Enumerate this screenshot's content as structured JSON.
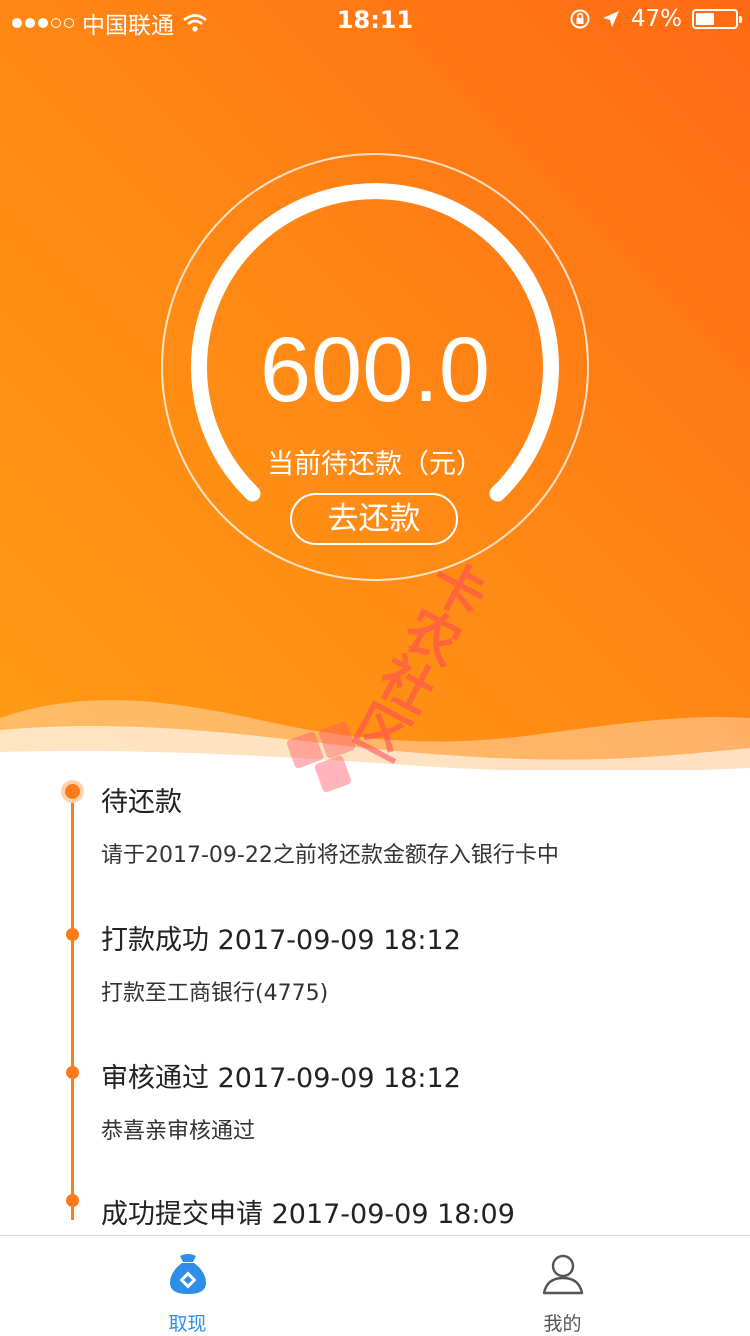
{
  "status_bar": {
    "carrier": "中国联通",
    "time": "18:11",
    "battery_text": "47%",
    "battery_level": 0.47
  },
  "hero": {
    "amount": "600.0",
    "amount_label": "当前待还款（元）",
    "repay_button": "去还款",
    "gradient_colors": [
      "#ff9a12",
      "#ff6a14"
    ],
    "watermark_text": "卡农社区"
  },
  "timeline": {
    "accent_color": "#ff7a1a",
    "steps": [
      {
        "title": "待还款",
        "desc": "请于2017-09-22之前将还款金额存入银行卡中"
      },
      {
        "title": "打款成功 2017-09-09 18:12",
        "desc": "打款至工商银行(4775)"
      },
      {
        "title": "审核通过 2017-09-09 18:12",
        "desc": "恭喜亲审核通过"
      },
      {
        "title": "成功提交申请 2017-09-09 18:09",
        "desc": ""
      }
    ]
  },
  "tabbar": {
    "active_color": "#2f8fe6",
    "inactive_color": "#555555",
    "items": [
      {
        "label": "取现",
        "icon": "money-bag-icon",
        "active": true
      },
      {
        "label": "我的",
        "icon": "user-icon",
        "active": false
      }
    ]
  }
}
